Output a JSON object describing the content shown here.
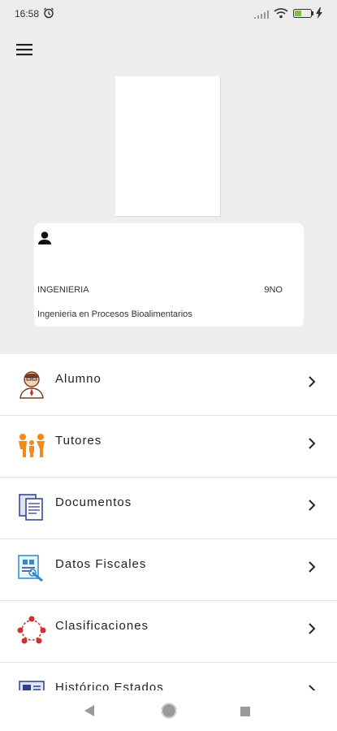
{
  "status_bar": {
    "time": "16:58",
    "battery_level": "18"
  },
  "profile": {
    "faculty": "INGENIERIA",
    "semester": "9NO",
    "program": "Ingenieria en Procesos Bioalimentarios"
  },
  "menu": {
    "items": [
      {
        "label": "Alumno",
        "icon": "student-icon"
      },
      {
        "label": "Tutores",
        "icon": "family-icon"
      },
      {
        "label": "Documentos",
        "icon": "documents-icon"
      },
      {
        "label": "Datos Fiscales",
        "icon": "tax-data-icon"
      },
      {
        "label": "Clasificaciones",
        "icon": "network-icon"
      },
      {
        "label": "Histórico Estados",
        "icon": "history-icon"
      }
    ]
  },
  "colors": {
    "accent_orange": "#f08a1c",
    "accent_red": "#d32f2f",
    "accent_blue": "#2c3e8c"
  }
}
